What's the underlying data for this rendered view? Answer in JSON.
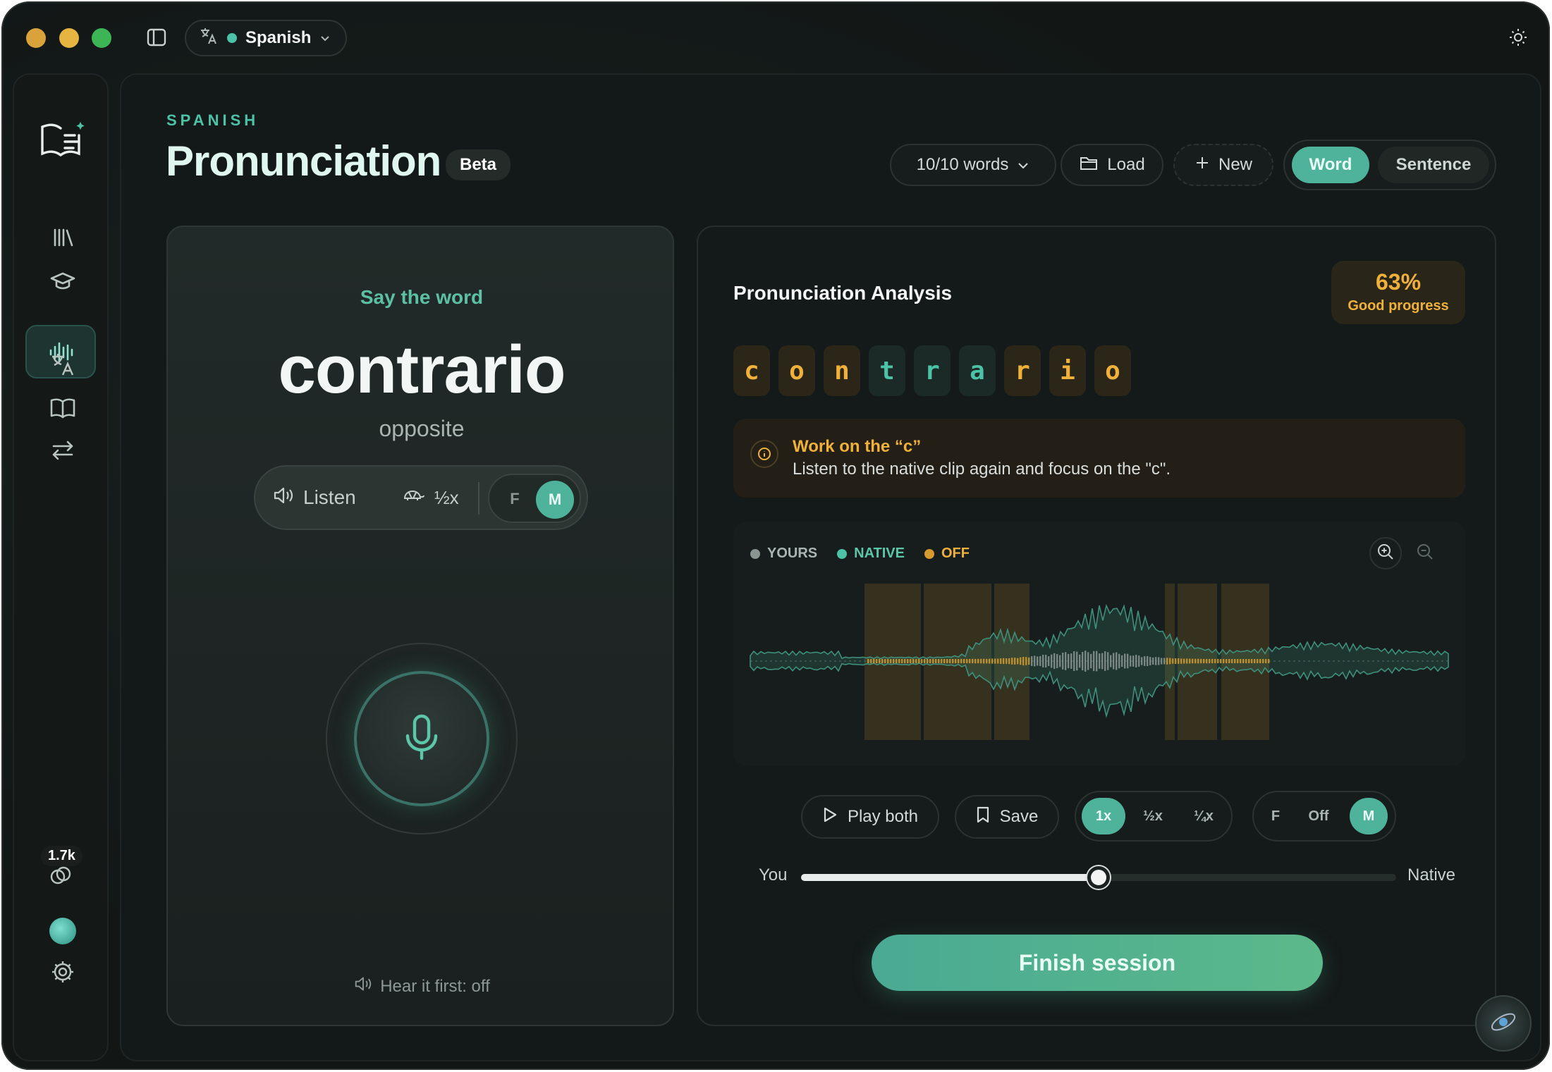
{
  "topbar": {
    "language": "Spanish",
    "language_dot_color": "#4cc2a6"
  },
  "rail": {
    "items": [
      {
        "icon": "library-icon"
      },
      {
        "icon": "graduation-cap-icon"
      },
      {
        "icon": "waveform-icon",
        "active": true
      },
      {
        "icon": "translate-icon"
      },
      {
        "icon": "book-icon"
      },
      {
        "icon": "swap-arrows-icon"
      }
    ],
    "streak_count": "1.7k"
  },
  "header": {
    "eyebrow": "SPANISH",
    "title": "Pronunciation",
    "badge": "Beta",
    "word_count": "10/10 words",
    "load_label": "Load",
    "new_label": "New",
    "mode_options": [
      "Word",
      "Sentence"
    ],
    "mode_selected": "Word"
  },
  "word_card": {
    "prompt": "Say the word",
    "word": "contrario",
    "translation": "opposite",
    "listen_label": "Listen",
    "slow_label": "½x",
    "voice_f": "F",
    "voice_m": "M",
    "voice_selected": "M",
    "hear_first": "Hear it first: off"
  },
  "analysis": {
    "title": "Pronunciation Analysis",
    "score": "63%",
    "score_label": "Good progress",
    "letters": [
      {
        "char": "c",
        "status": "off"
      },
      {
        "char": "o",
        "status": "off"
      },
      {
        "char": "n",
        "status": "off"
      },
      {
        "char": "t",
        "status": "good"
      },
      {
        "char": "r",
        "status": "good"
      },
      {
        "char": "a",
        "status": "good"
      },
      {
        "char": "r",
        "status": "off"
      },
      {
        "char": "i",
        "status": "off"
      },
      {
        "char": "o",
        "status": "off"
      }
    ],
    "tip_title": "Work on the “c”",
    "tip_body": "Listen to the native clip again and focus on the \"c\".",
    "legend": {
      "yours": "YOURS",
      "native": "NATIVE",
      "off": "OFF"
    },
    "colors": {
      "good": "#4cc2a6",
      "off": "#f0b13a",
      "yours": "#8a9491"
    },
    "play_both": "Play both",
    "save": "Save",
    "speeds": [
      "1x",
      "½x",
      "¼x"
    ],
    "speed_selected": "1x",
    "voices": [
      "F",
      "Off",
      "M"
    ],
    "voice_selected": "M",
    "slider_left": "You",
    "slider_right": "Native",
    "blend": 0.5,
    "finish": "Finish session"
  }
}
